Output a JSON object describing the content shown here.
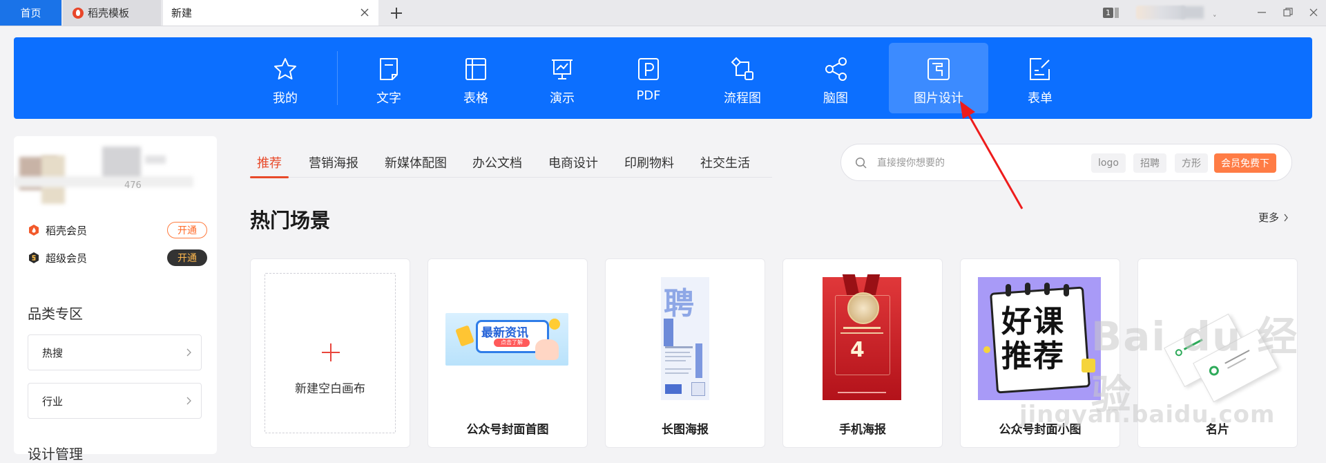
{
  "tabs": {
    "home": "首页",
    "docer": "稻壳模板",
    "new": "新建",
    "count_badge": "1"
  },
  "categories": [
    {
      "label": "我的",
      "icon": "star-icon"
    },
    {
      "label": "文字",
      "icon": "document-icon"
    },
    {
      "label": "表格",
      "icon": "table-icon"
    },
    {
      "label": "演示",
      "icon": "presentation-icon"
    },
    {
      "label": "PDF",
      "icon": "pdf-icon"
    },
    {
      "label": "流程图",
      "icon": "flowchart-icon"
    },
    {
      "label": "脑图",
      "icon": "mindmap-icon"
    },
    {
      "label": "图片设计",
      "icon": "image-design-icon",
      "active": true
    },
    {
      "label": "表单",
      "icon": "form-icon"
    }
  ],
  "sidebar": {
    "profile_digits": "476",
    "memberships": [
      {
        "label": "稻壳会员",
        "action": "开通"
      },
      {
        "label": "超级会员",
        "action": "开通"
      }
    ],
    "section_title": "品类专区",
    "items": [
      {
        "label": "热搜"
      },
      {
        "label": "行业"
      }
    ],
    "bottom_title": "设计管理"
  },
  "subtabs": [
    {
      "label": "推荐",
      "active": true
    },
    {
      "label": "营销海报"
    },
    {
      "label": "新媒体配图"
    },
    {
      "label": "办公文档"
    },
    {
      "label": "电商设计"
    },
    {
      "label": "印刷物料"
    },
    {
      "label": "社交生活"
    }
  ],
  "search": {
    "placeholder": "直接搜你想要的",
    "chips": [
      "logo",
      "招聘",
      "方形"
    ],
    "vip_chip": "会员免费下"
  },
  "section": {
    "title": "热门场景",
    "more": "更多"
  },
  "cards": [
    {
      "label": "新建空白画布"
    },
    {
      "label": "公众号封面首图",
      "thumb_text": "最新资讯",
      "thumb_sub": "点击了解"
    },
    {
      "label": "长图海报",
      "thumb_text": "聘"
    },
    {
      "label": "手机海报",
      "thumb_text": "4"
    },
    {
      "label": "公众号封面小图",
      "thumb_text": "好课推荐"
    },
    {
      "label": "名片"
    }
  ],
  "watermark": {
    "text": "Bai du 经验",
    "url": "jingyan.baidu.com"
  },
  "colors": {
    "brand_blue": "#0c6fff",
    "accent_red": "#e84a2a",
    "vip_orange": "#ff7c45"
  }
}
